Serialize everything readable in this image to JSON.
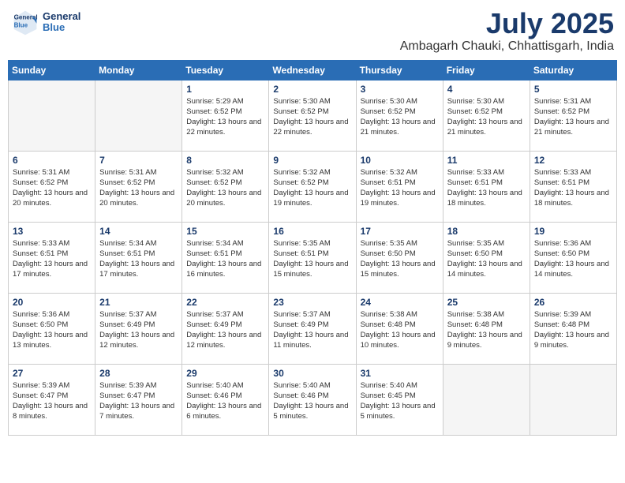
{
  "header": {
    "logo_line1": "General",
    "logo_line2": "Blue",
    "title": "July 2025",
    "location": "Ambagarh Chauki, Chhattisgarh, India"
  },
  "weekdays": [
    "Sunday",
    "Monday",
    "Tuesday",
    "Wednesday",
    "Thursday",
    "Friday",
    "Saturday"
  ],
  "weeks": [
    [
      {
        "day": "",
        "empty": true
      },
      {
        "day": "",
        "empty": true
      },
      {
        "day": "1",
        "sr": "Sunrise: 5:29 AM",
        "ss": "Sunset: 6:52 PM",
        "dl": "Daylight: 13 hours and 22 minutes."
      },
      {
        "day": "2",
        "sr": "Sunrise: 5:30 AM",
        "ss": "Sunset: 6:52 PM",
        "dl": "Daylight: 13 hours and 22 minutes."
      },
      {
        "day": "3",
        "sr": "Sunrise: 5:30 AM",
        "ss": "Sunset: 6:52 PM",
        "dl": "Daylight: 13 hours and 21 minutes."
      },
      {
        "day": "4",
        "sr": "Sunrise: 5:30 AM",
        "ss": "Sunset: 6:52 PM",
        "dl": "Daylight: 13 hours and 21 minutes."
      },
      {
        "day": "5",
        "sr": "Sunrise: 5:31 AM",
        "ss": "Sunset: 6:52 PM",
        "dl": "Daylight: 13 hours and 21 minutes."
      }
    ],
    [
      {
        "day": "6",
        "sr": "Sunrise: 5:31 AM",
        "ss": "Sunset: 6:52 PM",
        "dl": "Daylight: 13 hours and 20 minutes."
      },
      {
        "day": "7",
        "sr": "Sunrise: 5:31 AM",
        "ss": "Sunset: 6:52 PM",
        "dl": "Daylight: 13 hours and 20 minutes."
      },
      {
        "day": "8",
        "sr": "Sunrise: 5:32 AM",
        "ss": "Sunset: 6:52 PM",
        "dl": "Daylight: 13 hours and 20 minutes."
      },
      {
        "day": "9",
        "sr": "Sunrise: 5:32 AM",
        "ss": "Sunset: 6:52 PM",
        "dl": "Daylight: 13 hours and 19 minutes."
      },
      {
        "day": "10",
        "sr": "Sunrise: 5:32 AM",
        "ss": "Sunset: 6:51 PM",
        "dl": "Daylight: 13 hours and 19 minutes."
      },
      {
        "day": "11",
        "sr": "Sunrise: 5:33 AM",
        "ss": "Sunset: 6:51 PM",
        "dl": "Daylight: 13 hours and 18 minutes."
      },
      {
        "day": "12",
        "sr": "Sunrise: 5:33 AM",
        "ss": "Sunset: 6:51 PM",
        "dl": "Daylight: 13 hours and 18 minutes."
      }
    ],
    [
      {
        "day": "13",
        "sr": "Sunrise: 5:33 AM",
        "ss": "Sunset: 6:51 PM",
        "dl": "Daylight: 13 hours and 17 minutes."
      },
      {
        "day": "14",
        "sr": "Sunrise: 5:34 AM",
        "ss": "Sunset: 6:51 PM",
        "dl": "Daylight: 13 hours and 17 minutes."
      },
      {
        "day": "15",
        "sr": "Sunrise: 5:34 AM",
        "ss": "Sunset: 6:51 PM",
        "dl": "Daylight: 13 hours and 16 minutes."
      },
      {
        "day": "16",
        "sr": "Sunrise: 5:35 AM",
        "ss": "Sunset: 6:51 PM",
        "dl": "Daylight: 13 hours and 15 minutes."
      },
      {
        "day": "17",
        "sr": "Sunrise: 5:35 AM",
        "ss": "Sunset: 6:50 PM",
        "dl": "Daylight: 13 hours and 15 minutes."
      },
      {
        "day": "18",
        "sr": "Sunrise: 5:35 AM",
        "ss": "Sunset: 6:50 PM",
        "dl": "Daylight: 13 hours and 14 minutes."
      },
      {
        "day": "19",
        "sr": "Sunrise: 5:36 AM",
        "ss": "Sunset: 6:50 PM",
        "dl": "Daylight: 13 hours and 14 minutes."
      }
    ],
    [
      {
        "day": "20",
        "sr": "Sunrise: 5:36 AM",
        "ss": "Sunset: 6:50 PM",
        "dl": "Daylight: 13 hours and 13 minutes."
      },
      {
        "day": "21",
        "sr": "Sunrise: 5:37 AM",
        "ss": "Sunset: 6:49 PM",
        "dl": "Daylight: 13 hours and 12 minutes."
      },
      {
        "day": "22",
        "sr": "Sunrise: 5:37 AM",
        "ss": "Sunset: 6:49 PM",
        "dl": "Daylight: 13 hours and 12 minutes."
      },
      {
        "day": "23",
        "sr": "Sunrise: 5:37 AM",
        "ss": "Sunset: 6:49 PM",
        "dl": "Daylight: 13 hours and 11 minutes."
      },
      {
        "day": "24",
        "sr": "Sunrise: 5:38 AM",
        "ss": "Sunset: 6:48 PM",
        "dl": "Daylight: 13 hours and 10 minutes."
      },
      {
        "day": "25",
        "sr": "Sunrise: 5:38 AM",
        "ss": "Sunset: 6:48 PM",
        "dl": "Daylight: 13 hours and 9 minutes."
      },
      {
        "day": "26",
        "sr": "Sunrise: 5:39 AM",
        "ss": "Sunset: 6:48 PM",
        "dl": "Daylight: 13 hours and 9 minutes."
      }
    ],
    [
      {
        "day": "27",
        "sr": "Sunrise: 5:39 AM",
        "ss": "Sunset: 6:47 PM",
        "dl": "Daylight: 13 hours and 8 minutes."
      },
      {
        "day": "28",
        "sr": "Sunrise: 5:39 AM",
        "ss": "Sunset: 6:47 PM",
        "dl": "Daylight: 13 hours and 7 minutes."
      },
      {
        "day": "29",
        "sr": "Sunrise: 5:40 AM",
        "ss": "Sunset: 6:46 PM",
        "dl": "Daylight: 13 hours and 6 minutes."
      },
      {
        "day": "30",
        "sr": "Sunrise: 5:40 AM",
        "ss": "Sunset: 6:46 PM",
        "dl": "Daylight: 13 hours and 5 minutes."
      },
      {
        "day": "31",
        "sr": "Sunrise: 5:40 AM",
        "ss": "Sunset: 6:45 PM",
        "dl": "Daylight: 13 hours and 5 minutes."
      },
      {
        "day": "",
        "empty": true
      },
      {
        "day": "",
        "empty": true
      }
    ]
  ]
}
